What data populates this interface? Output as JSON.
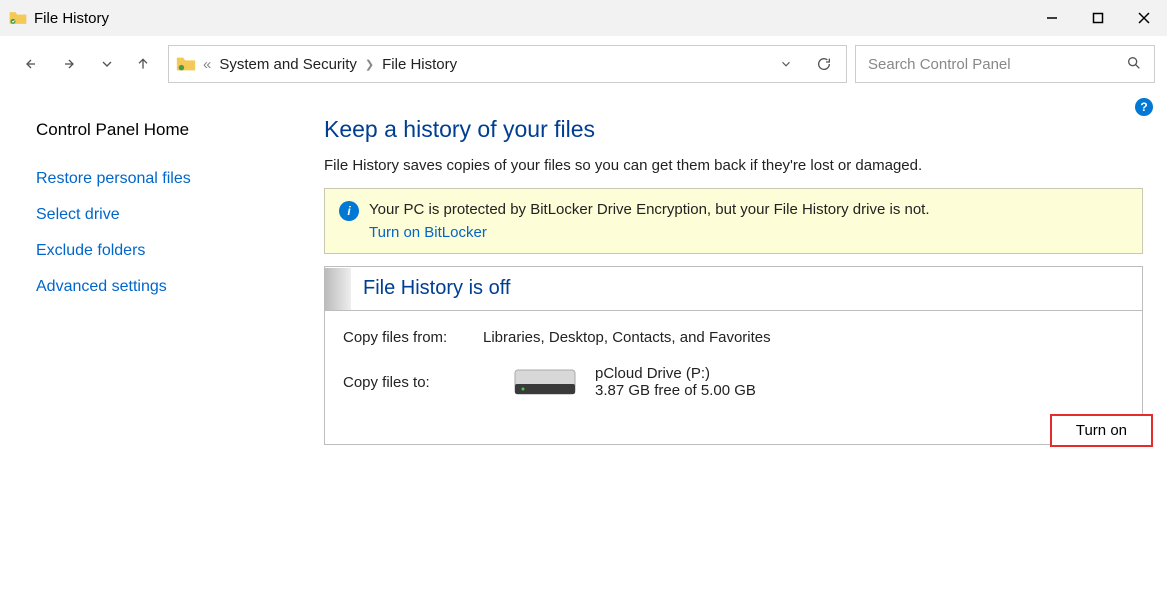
{
  "window": {
    "title": "File History"
  },
  "breadcrumbs": {
    "prefix": "«",
    "item1": "System and Security",
    "item2": "File History"
  },
  "search": {
    "placeholder": "Search Control Panel"
  },
  "sidebar": {
    "home": "Control Panel Home",
    "links": {
      "restore": "Restore personal files",
      "select_drive": "Select drive",
      "exclude": "Exclude folders",
      "advanced": "Advanced settings"
    }
  },
  "main": {
    "heading": "Keep a history of your files",
    "description": "File History saves copies of your files so you can get them back if they're lost or damaged.",
    "notice": {
      "text": "Your PC is protected by BitLocker Drive Encryption, but your File History drive is not.",
      "link": "Turn on BitLocker"
    },
    "status": {
      "title": "File History is off",
      "from_label": "Copy files from:",
      "from_value": "Libraries, Desktop, Contacts, and Favorites",
      "to_label": "Copy files to:",
      "drive_name": "pCloud Drive (P:)",
      "drive_space": "3.87 GB free of 5.00 GB"
    },
    "button": "Turn on"
  },
  "help_label": "?"
}
